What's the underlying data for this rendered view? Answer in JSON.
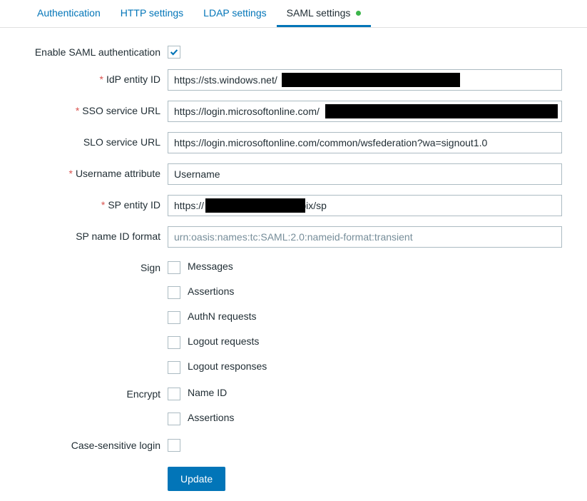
{
  "tabs": [
    {
      "label": "Authentication",
      "active": false,
      "dot": false
    },
    {
      "label": "HTTP settings",
      "active": false,
      "dot": false
    },
    {
      "label": "LDAP settings",
      "active": false,
      "dot": false
    },
    {
      "label": "SAML settings",
      "active": true,
      "dot": true
    }
  ],
  "form": {
    "enable_label": "Enable SAML authentication",
    "enable_checked": true,
    "idp_entity_id": {
      "label": "IdP entity ID",
      "required": true,
      "value": "https://sts.windows.net/",
      "redacted": true
    },
    "sso_url": {
      "label": "SSO service URL",
      "required": true,
      "value": "https://login.microsoftonline.com/",
      "redacted": true
    },
    "slo_url": {
      "label": "SLO service URL",
      "required": false,
      "value": "https://login.microsoftonline.com/common/wsfederation?wa=signout1.0"
    },
    "username_attr": {
      "label": "Username attribute",
      "required": true,
      "value": "Username"
    },
    "sp_entity_id": {
      "label": "SP entity ID",
      "required": true,
      "value_prefix": "https://",
      "value_suffix": "/zabbix/sp",
      "redacted": true
    },
    "sp_name_id": {
      "label": "SP name ID format",
      "required": false,
      "placeholder": "urn:oasis:names:tc:SAML:2.0:nameid-format:transient",
      "value": ""
    },
    "sign": {
      "label": "Sign",
      "options": [
        "Messages",
        "Assertions",
        "AuthN requests",
        "Logout requests",
        "Logout responses"
      ]
    },
    "encrypt": {
      "label": "Encrypt",
      "options": [
        "Name ID",
        "Assertions"
      ]
    },
    "case_sensitive": {
      "label": "Case-sensitive login",
      "checked": false
    },
    "update_button": "Update"
  }
}
